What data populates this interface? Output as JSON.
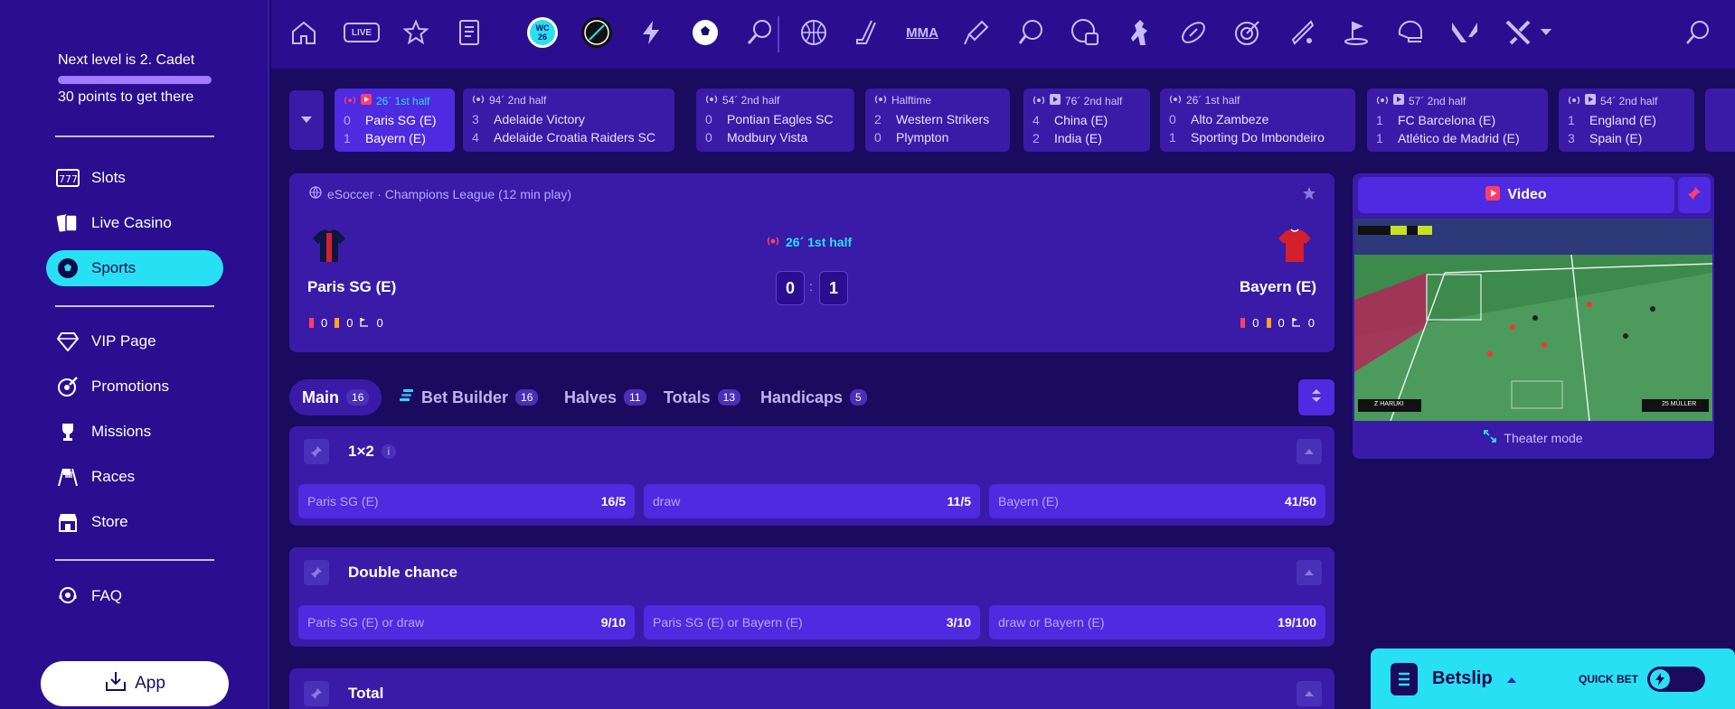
{
  "sidebar": {
    "level_text": "Next level is 2. Cadet",
    "points_text": "30 points to get there",
    "level_progress_pct": 100,
    "items": [
      {
        "label": "Slots",
        "icon": "slots-icon"
      },
      {
        "label": "Live Casino",
        "icon": "cards-icon"
      },
      {
        "label": "Sports",
        "icon": "soccer-ball-icon",
        "active": true
      },
      {
        "label": "VIP Page",
        "icon": "diamond-icon"
      },
      {
        "label": "Promotions",
        "icon": "rocket-icon"
      },
      {
        "label": "Missions",
        "icon": "trophy-icon"
      },
      {
        "label": "Races",
        "icon": "flags-icon"
      },
      {
        "label": "Store",
        "icon": "store-icon"
      },
      {
        "label": "FAQ",
        "icon": "support-icon"
      }
    ],
    "app_label": "App"
  },
  "topnav": {
    "live_label": "LIVE",
    "mma_label": "MMA",
    "wc_badge": "WC 26"
  },
  "live_events": [
    {
      "status": "26´ 1st half",
      "live": true,
      "video": true,
      "home": "Paris SG (E)",
      "away": "Bayern (E)",
      "hs": "0",
      "as": "1"
    },
    {
      "status": "94´ 2nd half",
      "live": false,
      "video": false,
      "home": "Adelaide Victory",
      "away": "Adelaide Croatia Raiders SC",
      "hs": "3",
      "as": "4"
    },
    {
      "status": "54´ 2nd half",
      "live": false,
      "video": false,
      "home": "Pontian Eagles SC",
      "away": "Modbury Vista",
      "hs": "0",
      "as": "0"
    },
    {
      "status": "Halftime",
      "live": false,
      "video": false,
      "home": "Western Strikers",
      "away": "Plympton",
      "hs": "2",
      "as": "0"
    },
    {
      "status": "76´ 2nd half",
      "live": false,
      "video": true,
      "home": "China (E)",
      "away": "India (E)",
      "hs": "4",
      "as": "2"
    },
    {
      "status": "26´ 1st half",
      "live": false,
      "video": false,
      "home": "Alto Zambeze",
      "away": "Sporting Do Imbondeiro",
      "hs": "0",
      "as": "1"
    },
    {
      "status": "57´ 2nd half",
      "live": false,
      "video": true,
      "home": "FC Barcelona (E)",
      "away": "Atlético de Madrid (E)",
      "hs": "1",
      "as": "1"
    },
    {
      "status": "54´ 2nd half",
      "live": false,
      "video": true,
      "home": "England (E)",
      "away": "Spain (E)",
      "hs": "1",
      "as": "3"
    }
  ],
  "match": {
    "crumb": "eSoccer · Champions League (12 min play)",
    "live_label": "26´ 1st half",
    "home": "Paris SG (E)",
    "away": "Bayern (E)",
    "home_score": "0",
    "away_score": "1",
    "colon": ":",
    "home_stats": {
      "red": "0",
      "yellow": "0",
      "corners": "0"
    },
    "away_stats": {
      "red": "0",
      "yellow": "0",
      "corners": "0"
    }
  },
  "tabs": [
    {
      "label": "Main",
      "count": "16",
      "active": true
    },
    {
      "label": "Bet Builder",
      "count": "16"
    },
    {
      "label": "Halves",
      "count": "11"
    },
    {
      "label": "Totals",
      "count": "13"
    },
    {
      "label": "Handicaps",
      "count": "5"
    }
  ],
  "markets": [
    {
      "title": "1×2",
      "info": "i",
      "odds": [
        {
          "label": "Paris SG (E)",
          "value": "16/5"
        },
        {
          "label": "draw",
          "value": "11/5"
        },
        {
          "label": "Bayern (E)",
          "value": "41/50"
        }
      ]
    },
    {
      "title": "Double chance",
      "odds": [
        {
          "label": "Paris SG (E) or draw",
          "value": "9/10"
        },
        {
          "label": "Paris SG (E) or Bayern (E)",
          "value": "3/10"
        },
        {
          "label": "draw or Bayern (E)",
          "value": "19/100"
        }
      ]
    },
    {
      "title": "Total"
    }
  ],
  "video": {
    "title": "Video",
    "theater_label": "Theater mode",
    "home_player": "Z HARUKI",
    "away_player": "25 MÜLLER"
  },
  "betslip": {
    "title": "Betslip",
    "quick_bet_label": "QUICK BET"
  },
  "colors": {
    "bg": "#1a0b5e",
    "panel": "#3a1ba8",
    "accent": "#28e0f4",
    "live_red": "#ff3d6a"
  }
}
